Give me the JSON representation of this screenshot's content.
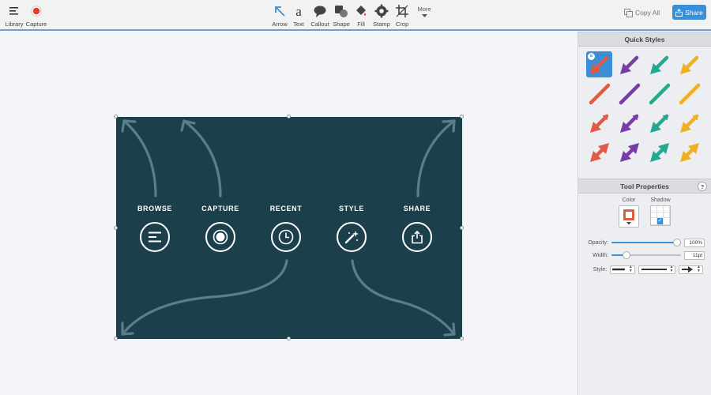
{
  "toolbar": {
    "library": {
      "label": "Library",
      "icon": "library-icon"
    },
    "capture": {
      "label": "Capture",
      "icon": "record-icon"
    },
    "tools": [
      {
        "label": "Arrow",
        "icon": "arrow-icon"
      },
      {
        "label": "Text",
        "icon": "text-icon"
      },
      {
        "label": "Callout",
        "icon": "callout-icon"
      },
      {
        "label": "Shape",
        "icon": "shape-icon"
      },
      {
        "label": "Fill",
        "icon": "fill-icon"
      },
      {
        "label": "Stamp",
        "icon": "stamp-icon"
      },
      {
        "label": "Crop",
        "icon": "crop-icon"
      }
    ],
    "more_label": "More",
    "copy_all_label": "Copy All",
    "share_label": "Share",
    "accent": "#3a8fd6"
  },
  "canvas": {
    "image_background": "#1c3f4c",
    "features": [
      {
        "label": "BROWSE",
        "icon": "menu-icon"
      },
      {
        "label": "CAPTURE",
        "icon": "record-button-icon"
      },
      {
        "label": "RECENT",
        "icon": "clock-icon"
      },
      {
        "label": "STYLE",
        "icon": "magic-wand-icon"
      },
      {
        "label": "SHARE",
        "icon": "share-icon"
      }
    ]
  },
  "quick_styles": {
    "title": "Quick Styles",
    "colors": [
      "#e05a44",
      "#7a3aa8",
      "#22a98f",
      "#f0b020"
    ],
    "rows": [
      "arrow",
      "line",
      "double-arrow",
      "bidirectional-arrow"
    ],
    "selected_index": 0
  },
  "tool_properties": {
    "title": "Tool Properties",
    "help_label": "?",
    "color_label": "Color",
    "shadow_label": "Shadow",
    "current_color": "#e05a44",
    "shadow_enabled": true,
    "opacity_label": "Opacity:",
    "opacity_value": "100%",
    "opacity_level": 1.0,
    "width_label": "Width:",
    "width_value": "11pt",
    "width_level": 0.18,
    "style_label": "Style:"
  }
}
